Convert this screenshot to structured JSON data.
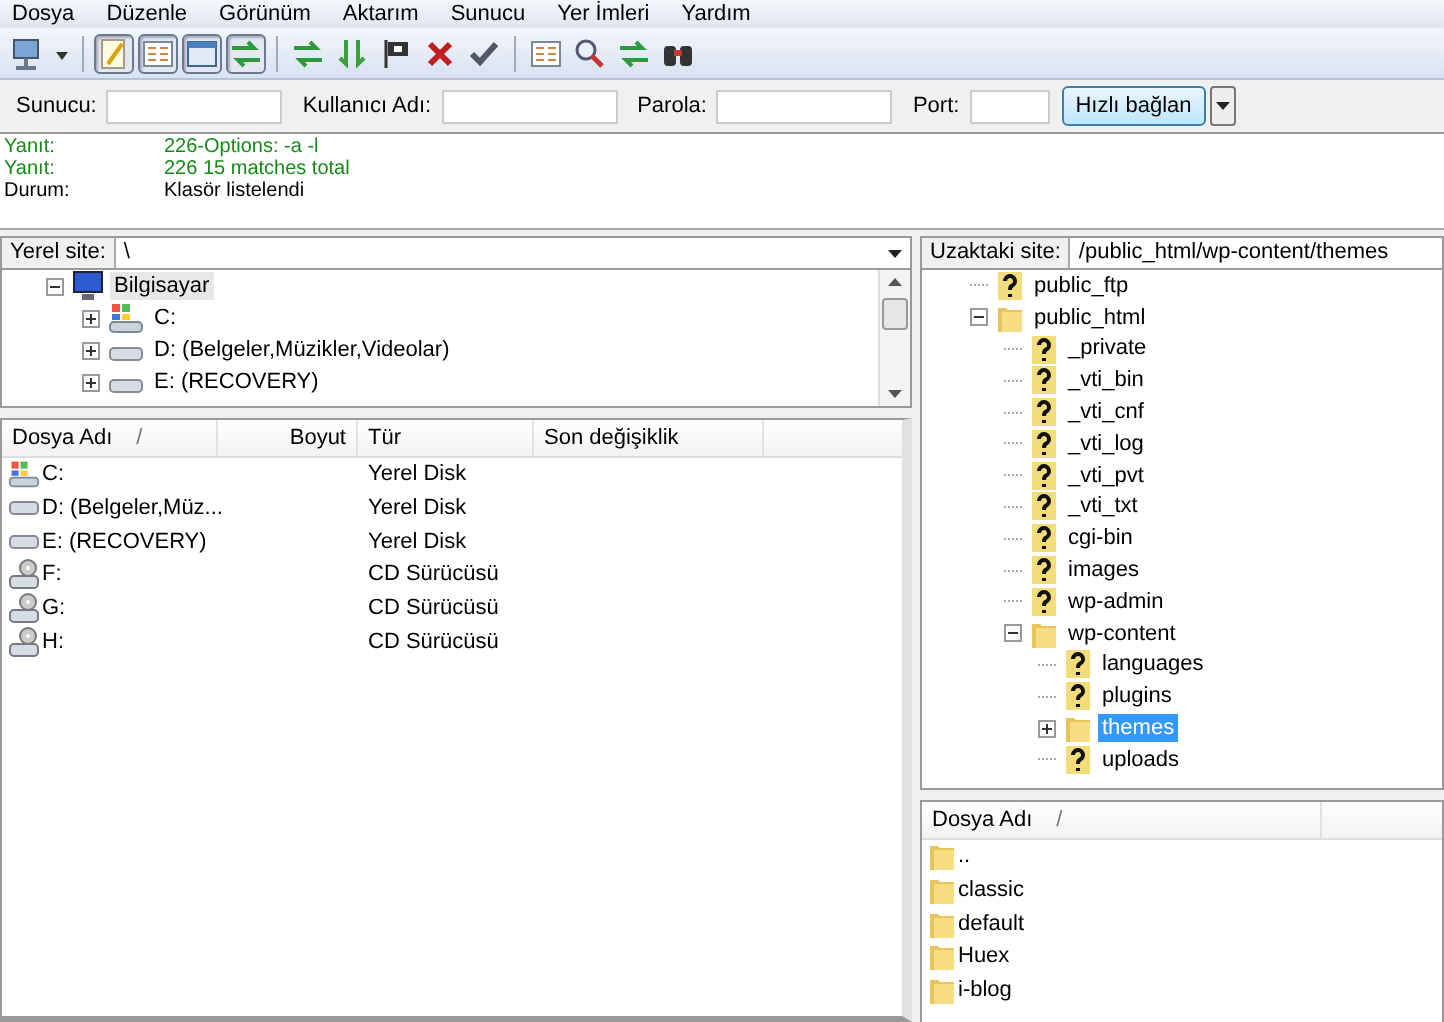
{
  "menu": [
    "Dosya",
    "Düzenle",
    "Görünüm",
    "Aktarım",
    "Sunucu",
    "Yer İmleri",
    "Yardım"
  ],
  "toolbar": [
    {
      "kind": "monitor"
    },
    {
      "kind": "caret"
    },
    {
      "kind": "sep"
    },
    {
      "kind": "notepad",
      "pressed": true
    },
    {
      "kind": "list",
      "pressed": true
    },
    {
      "kind": "window",
      "pressed": true
    },
    {
      "kind": "arrows",
      "pressed": true
    },
    {
      "kind": "sep"
    },
    {
      "kind": "arrows"
    },
    {
      "kind": "down-arrows"
    },
    {
      "kind": "flag"
    },
    {
      "kind": "cross"
    },
    {
      "kind": "check"
    },
    {
      "kind": "sep"
    },
    {
      "kind": "list"
    },
    {
      "kind": "magnifier"
    },
    {
      "kind": "arrows"
    },
    {
      "kind": "binoculars"
    }
  ],
  "quickconnect": {
    "fields": [
      {
        "label": "Sunucu:",
        "wide": true
      },
      {
        "label": "Kullanıcı Adı:",
        "wide": true
      },
      {
        "label": "Parola:",
        "wide": true
      },
      {
        "label": "Port:",
        "wide": false
      }
    ],
    "button": "Hızlı bağlan"
  },
  "log": [
    {
      "kind": "response",
      "label": "Yanıt:",
      "text": "226-Options: -a -l"
    },
    {
      "kind": "response",
      "label": "Yanıt:",
      "text": "226 15 matches total"
    },
    {
      "kind": "status",
      "label": "Durum:",
      "text": "Klasör listelendi"
    }
  ],
  "local": {
    "site_label": "Yerel site:",
    "path": "\\",
    "tree": [
      {
        "label": "Bilgisayar",
        "kind": "computer",
        "expanded": true,
        "selected": false,
        "children": [
          {
            "label": "C:",
            "kind": "windows-drive",
            "expanded": false,
            "selected": false
          },
          {
            "label": "D: (Belgeler,Müzikler,Videolar)",
            "kind": "drive",
            "expanded": false,
            "selected": false
          },
          {
            "label": "E: (RECOVERY)",
            "kind": "drive",
            "expanded": false,
            "selected": false
          }
        ]
      }
    ],
    "columns": [
      "Dosya Adı",
      "Boyut",
      "Tür",
      "Son değişiklik"
    ],
    "sort_mark": "/",
    "rows": [
      {
        "name": "C:",
        "kind": "windows-drive",
        "type": "Yerel Disk"
      },
      {
        "name": "D: (Belgeler,Müz...",
        "kind": "drive",
        "type": "Yerel Disk"
      },
      {
        "name": "E: (RECOVERY)",
        "kind": "drive",
        "type": "Yerel Disk"
      },
      {
        "name": "F:",
        "kind": "cd",
        "type": "CD Sürücüsü"
      },
      {
        "name": "G:",
        "kind": "cd",
        "type": "CD Sürücüsü"
      },
      {
        "name": "H:",
        "kind": "cd",
        "type": "CD Sürücüsü"
      }
    ]
  },
  "remote": {
    "site_label": "Uzaktaki site:",
    "path": "/public_html/wp-content/themes",
    "tree": [
      {
        "label": "public_ftp",
        "kind": "unknown",
        "expanded": false,
        "selected": false
      },
      {
        "label": "public_html",
        "kind": "folder",
        "expanded": true,
        "selected": false,
        "children": [
          {
            "label": "_private",
            "kind": "unknown",
            "expanded": false,
            "selected": false
          },
          {
            "label": "_vti_bin",
            "kind": "unknown",
            "expanded": false,
            "selected": false
          },
          {
            "label": "_vti_cnf",
            "kind": "unknown",
            "expanded": false,
            "selected": false
          },
          {
            "label": "_vti_log",
            "kind": "unknown",
            "expanded": false,
            "selected": false
          },
          {
            "label": "_vti_pvt",
            "kind": "unknown",
            "expanded": false,
            "selected": false
          },
          {
            "label": "_vti_txt",
            "kind": "unknown",
            "expanded": false,
            "selected": false
          },
          {
            "label": "cgi-bin",
            "kind": "unknown",
            "expanded": false,
            "selected": false
          },
          {
            "label": "images",
            "kind": "unknown",
            "expanded": false,
            "selected": false
          },
          {
            "label": "wp-admin",
            "kind": "unknown",
            "expanded": false,
            "selected": false
          },
          {
            "label": "wp-content",
            "kind": "folder",
            "expanded": true,
            "selected": false,
            "children": [
              {
                "label": "languages",
                "kind": "unknown",
                "expanded": false,
                "selected": false
              },
              {
                "label": "plugins",
                "kind": "unknown",
                "expanded": false,
                "selected": false
              },
              {
                "label": "themes",
                "kind": "folder",
                "expanded": false,
                "selected": true,
                "expandable": true
              },
              {
                "label": "uploads",
                "kind": "unknown",
                "expanded": false,
                "selected": false
              }
            ]
          }
        ]
      }
    ],
    "columns": [
      "Dosya Adı"
    ],
    "sort_mark": "/",
    "rows": [
      {
        "name": ".."
      },
      {
        "name": "classic"
      },
      {
        "name": "default"
      },
      {
        "name": "Huex"
      },
      {
        "name": "i-blog"
      }
    ]
  }
}
